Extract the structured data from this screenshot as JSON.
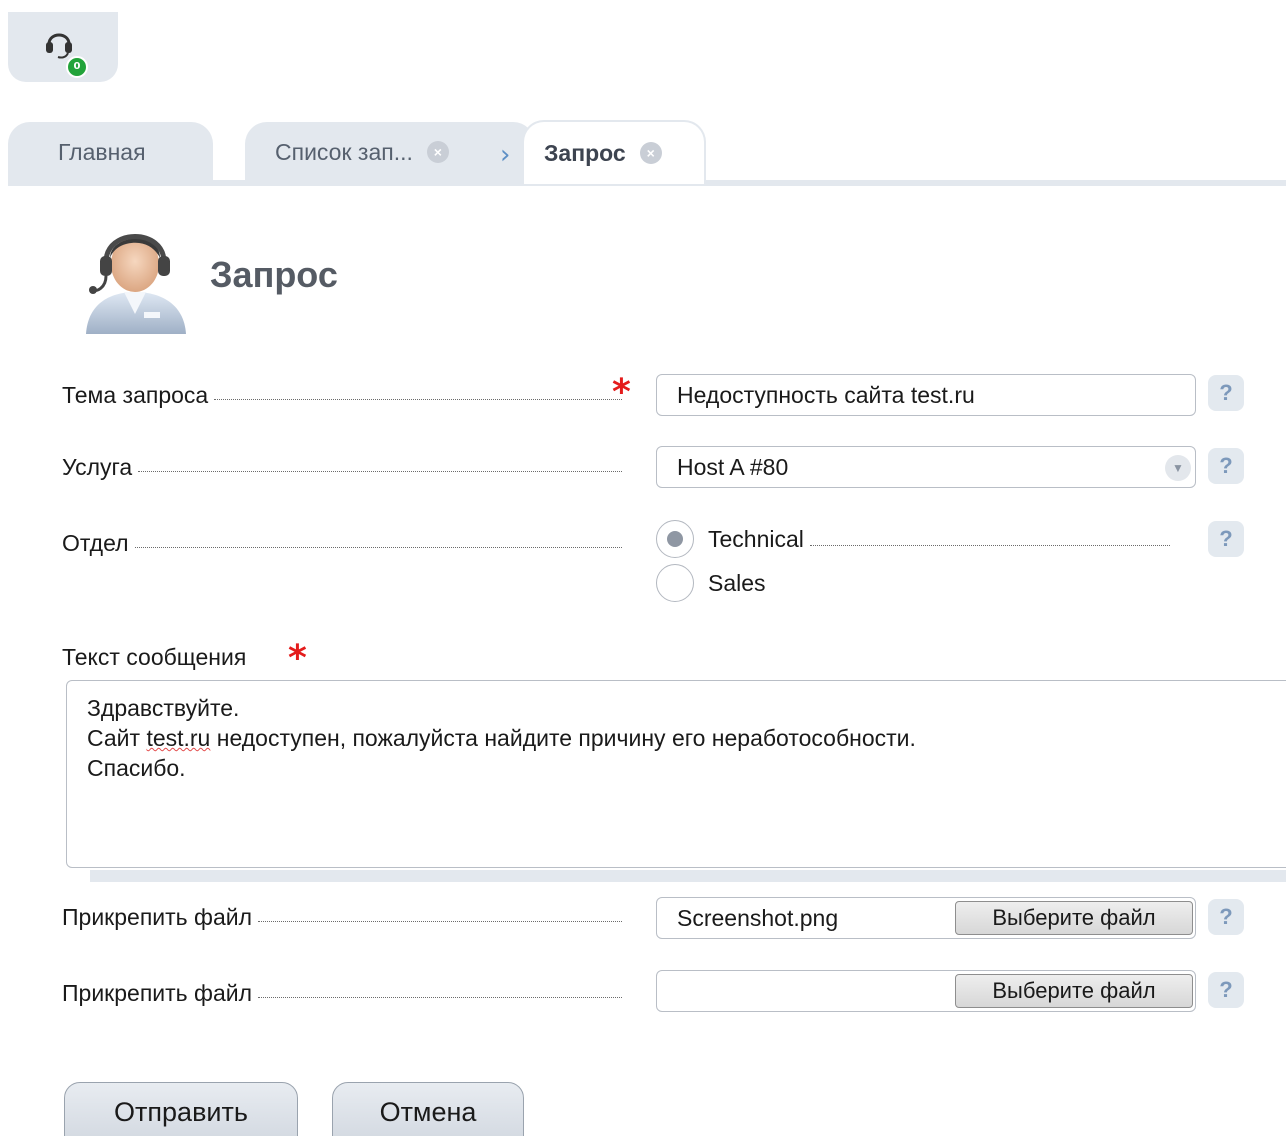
{
  "support": {
    "badge_count": "0"
  },
  "tabs": [
    {
      "label": "Главная"
    },
    {
      "label": "Список зап..."
    },
    {
      "label": "Запрос",
      "active": true
    }
  ],
  "page": {
    "title": "Запрос"
  },
  "form": {
    "subject": {
      "label": "Тема запроса",
      "value": "Недоступность сайта test.ru",
      "help": "?"
    },
    "service": {
      "label": "Услуга",
      "value": "Host A #80",
      "help": "?"
    },
    "department": {
      "label": "Отдел",
      "options": [
        {
          "label": "Technical",
          "checked": true
        },
        {
          "label": "Sales",
          "checked": false
        }
      ],
      "help": "?"
    },
    "message": {
      "label": "Текст сообщения",
      "lines": [
        "Здравствуйте.",
        "Сайт test.ru недоступен, пожалуйста найдите причину его неработособности.",
        "Спасибо."
      ],
      "line2_prefix": "Сайт ",
      "line2_link": "test.ru",
      "line2_suffix": " недоступен, пожалуйста найдите причину его неработособности."
    },
    "attach1": {
      "label": "Прикрепить файл",
      "value": "Screenshot.png",
      "button": "Выберите файл",
      "help": "?"
    },
    "attach2": {
      "label": "Прикрепить файл",
      "value": "",
      "button": "Выберите файл",
      "help": "?"
    }
  },
  "actions": {
    "submit": "Отправить",
    "cancel": "Отмена"
  },
  "colors": {
    "accent": "#e3e8ee",
    "required": "#e41c1c",
    "badge": "#22a33a",
    "help_text": "#7d99bb"
  }
}
